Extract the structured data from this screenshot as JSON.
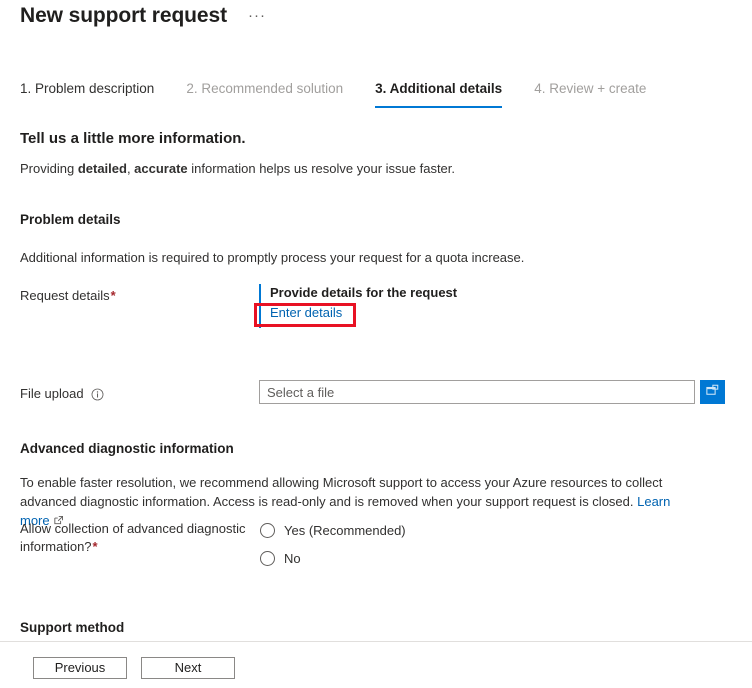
{
  "header": {
    "title": "New support request",
    "more_actions": "···"
  },
  "tabs": [
    {
      "label": "1. Problem description",
      "state": "done"
    },
    {
      "label": "2. Recommended solution",
      "state": "disabled"
    },
    {
      "label": "3. Additional details",
      "state": "active"
    },
    {
      "label": "4. Review + create",
      "state": "disabled"
    }
  ],
  "intro": {
    "heading": "Tell us a little more information.",
    "line_prefix": "Providing ",
    "bold_one": "detailed",
    "line_middle": ", ",
    "bold_two": "accurate",
    "line_suffix": " information helps us resolve your issue faster."
  },
  "problem_details": {
    "heading": "Problem details",
    "description": "Additional information is required to promptly process your request for a quota increase.",
    "request_details_label": "Request details",
    "request_details_required": "*",
    "provide_details_title": "Provide details for the request",
    "enter_details_link": "Enter details"
  },
  "file_upload": {
    "label": "File upload",
    "info_icon": "info-icon",
    "placeholder": "Select a file",
    "value": "",
    "browse_icon": "folder-open-icon"
  },
  "advanced": {
    "heading": "Advanced diagnostic information",
    "description_part1": "To enable faster resolution, we recommend allowing Microsoft support to access your Azure resources to collect advanced diagnostic information. Access is read-only and is removed when your support request is closed. ",
    "learn_more": "Learn more",
    "external_icon": "external-link-icon",
    "question_label": "Allow collection of advanced diagnostic information?",
    "question_required": "*",
    "options": [
      {
        "label": "Yes (Recommended)",
        "selected": false
      },
      {
        "label": "No",
        "selected": false
      }
    ]
  },
  "support_method": {
    "heading": "Support method"
  },
  "footer": {
    "previous": "Previous",
    "next": "Next"
  },
  "annotation": {
    "target": "enter-details-link",
    "color": "#e81123"
  },
  "colors": {
    "accent": "#0078d4",
    "link": "#0063b1",
    "required": "#a4262c",
    "highlight": "#e81123",
    "disabled_text": "#a19f9d"
  }
}
